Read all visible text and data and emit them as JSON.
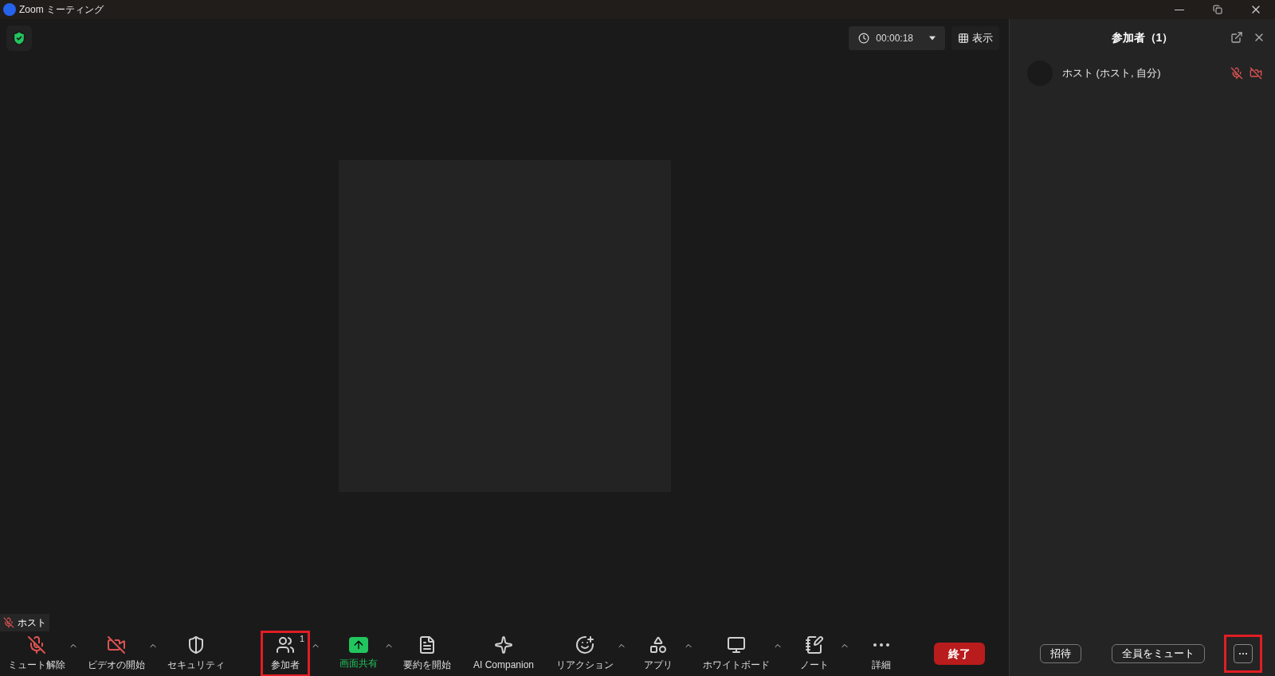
{
  "window": {
    "title": "Zoom ミーティング"
  },
  "meeting": {
    "secure": true,
    "timer": "00:00:18",
    "view_button": "表示",
    "self_label": "ホスト",
    "self_muted": true
  },
  "toolbar": {
    "items": [
      {
        "kind": "mic",
        "label": "ミュート解除",
        "off": true,
        "caret": true,
        "highlighted": false
      },
      {
        "kind": "video",
        "label": "ビデオの開始",
        "off": true,
        "caret": true,
        "highlighted": false
      },
      {
        "kind": "security",
        "label": "セキュリティ",
        "caret": false,
        "highlighted": false
      },
      {
        "kind": "participants",
        "label": "参加者",
        "badge": "1",
        "caret": true,
        "highlighted": true
      },
      {
        "kind": "share",
        "label": "画面共有",
        "caret": true,
        "highlighted": false
      },
      {
        "kind": "summary",
        "label": "要約を開始",
        "caret": false,
        "highlighted": false
      },
      {
        "kind": "ai",
        "label": "AI Companion",
        "caret": false,
        "highlighted": false
      },
      {
        "kind": "reaction",
        "label": "リアクション",
        "caret": true,
        "highlighted": false
      },
      {
        "kind": "apps",
        "label": "アプリ",
        "caret": true,
        "highlighted": false
      },
      {
        "kind": "whiteboard",
        "label": "ホワイトボード",
        "caret": true,
        "highlighted": false
      },
      {
        "kind": "notes",
        "label": "ノート",
        "caret": true,
        "highlighted": false
      },
      {
        "kind": "more",
        "label": "詳細",
        "caret": false,
        "highlighted": false
      }
    ],
    "end_button": "終了"
  },
  "panel": {
    "title": "参加者（1）",
    "participants": [
      {
        "name": "ホスト (ホスト, 自分)",
        "muted": true,
        "video_off": true
      }
    ],
    "buttons": [
      "招待",
      "全員をミュート"
    ],
    "more_highlighted": true
  }
}
